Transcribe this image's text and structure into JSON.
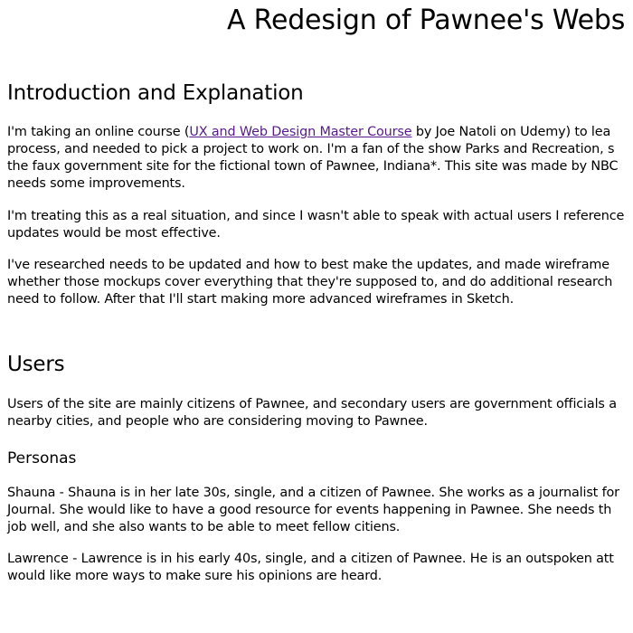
{
  "title": "A Redesign of Pawnee's Webs",
  "intro": {
    "heading": "Introduction and Explanation",
    "p1": {
      "l1_before": "I'm taking an online course (",
      "l1_link": "UX and Web Design Master Course",
      "l1_after": " by Joe Natoli on Udemy) to lea",
      "l2": "process, and needed to pick a project to work on. I'm a fan of the show Parks and Recreation, s",
      "l3": "the faux government site for the fictional town of Pawnee, Indiana*. This site was made by NBC",
      "l4": "needs some improvements."
    },
    "p2": {
      "l1": "I'm treating this as a real situation, and since I wasn't able to speak with actual users I reference",
      "l2": "updates would be most effective."
    },
    "p3": {
      "l1": "I've researched needs to be updated and how to best make the updates, and made wireframe",
      "l2": "whether those mockups cover everything that they're supposed to, and do additional research",
      "l3": "need to follow. After that I'll start making more advanced wireframes in Sketch."
    }
  },
  "users": {
    "heading": "Users",
    "p1": {
      "l1": "Users of the site are mainly citizens of Pawnee, and secondary users are government officials a",
      "l2": "nearby cities, and people who are considering moving to Pawnee."
    },
    "personas": {
      "heading": "Personas",
      "shauna": {
        "l1": "Shauna - Shauna is in her late 30s, single, and a citizen of Pawnee. She works as a journalist for",
        "l2": "Journal. She would like to have a good resource for events happening in Pawnee. She needs th",
        "l3": "job well, and she also wants to be able to meet fellow citiens."
      },
      "lawrence": {
        "l1": "Lawrence - Lawrence is in his early 40s, single, and a citizen of Pawnee. He is an outspoken att",
        "l2": "would like more ways to make sure his opinions are heard."
      }
    }
  }
}
